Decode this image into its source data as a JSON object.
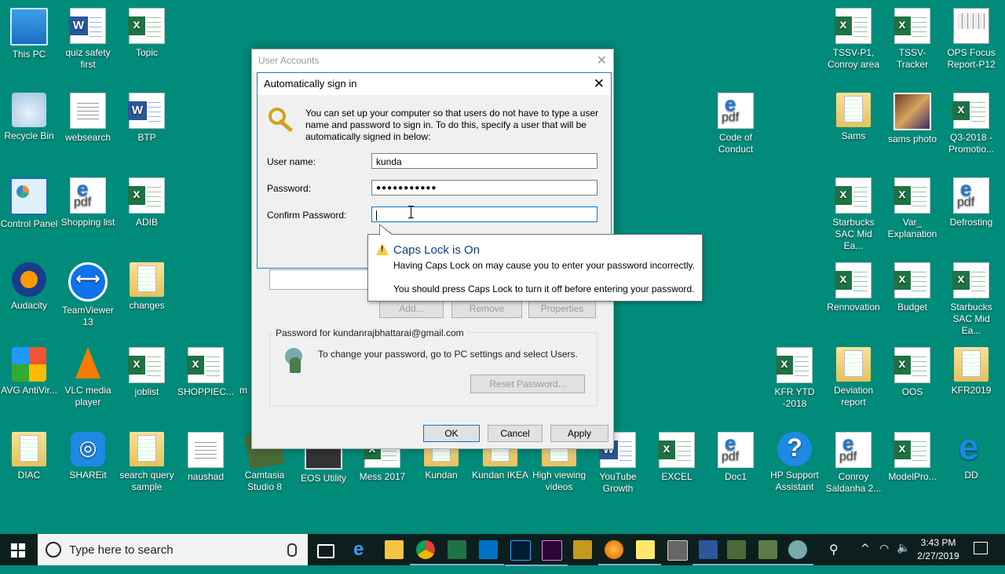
{
  "desktop": {
    "icons_left": [
      {
        "label": "This PC",
        "icon": "this-pc-icon"
      },
      {
        "label": "quiz safety first",
        "icon": "word-doc-icon"
      },
      {
        "label": "Topic",
        "icon": "excel-file-icon"
      },
      {
        "label": "Recycle Bin",
        "icon": "recycle-bin-icon"
      },
      {
        "label": "websearch",
        "icon": "document-icon"
      },
      {
        "label": "BTP",
        "icon": "word-doc-icon"
      },
      {
        "label": "Control Panel",
        "icon": "control-panel-icon"
      },
      {
        "label": "Shopping list",
        "icon": "pdf-icon"
      },
      {
        "label": "ADIB",
        "icon": "excel-file-icon"
      },
      {
        "label": "Audacity",
        "icon": "audacity-icon"
      },
      {
        "label": "TeamViewer 13",
        "icon": "teamviewer-icon"
      },
      {
        "label": "changes",
        "icon": "folder-icon"
      },
      {
        "label": "AVG AntiVir...",
        "icon": "avg-icon"
      },
      {
        "label": "VLC media player",
        "icon": "vlc-icon"
      },
      {
        "label": "joblist",
        "icon": "excel-file-icon"
      },
      {
        "label": "SHOPPIEC...",
        "icon": "excel-file-icon"
      },
      {
        "label": "m",
        "icon": "folder-icon"
      }
    ],
    "icons_bottom": [
      {
        "label": "DIAC",
        "icon": "folder-icon"
      },
      {
        "label": "SHAREit",
        "icon": "shareit-icon"
      },
      {
        "label": "search query sample",
        "icon": "folder-icon"
      },
      {
        "label": "naushad",
        "icon": "document-icon"
      },
      {
        "label": "Camtasia Studio 8",
        "icon": "camtasia-icon"
      },
      {
        "label": "EOS Utility",
        "icon": "eos-utility-icon"
      },
      {
        "label": "Mess 2017",
        "icon": "excel-file-icon"
      },
      {
        "label": "Kundan",
        "icon": "folder-icon"
      },
      {
        "label": "Kundan IKEA",
        "icon": "folder-icon"
      },
      {
        "label": "High viewing videos",
        "icon": "folder-icon"
      },
      {
        "label": "YouTube Growth",
        "icon": "word-doc-icon"
      },
      {
        "label": "EXCEL",
        "icon": "excel-file-icon"
      },
      {
        "label": "Doc1",
        "icon": "pdf-icon"
      },
      {
        "label": "HP Support Assistant",
        "icon": "help-icon"
      },
      {
        "label": "Conroy Saldanha 2...",
        "icon": "pdf-icon"
      },
      {
        "label": "ModelPro...",
        "icon": "excel-file-icon"
      },
      {
        "label": "DD",
        "icon": "internet-explorer-icon"
      }
    ],
    "icons_right": [
      {
        "label": "TSSV-P1, Conroy area",
        "icon": "excel-file-icon"
      },
      {
        "label": "TSSV-Tracker",
        "icon": "excel-file-icon"
      },
      {
        "label": "OPS Focus Report-P12",
        "icon": "spreadsheet-icon"
      },
      {
        "label": "Code of Conduct",
        "icon": "pdf-icon"
      },
      {
        "label": "Sams",
        "icon": "folder-icon"
      },
      {
        "label": "sams photo",
        "icon": "photo-icon"
      },
      {
        "label": "Q3-2018 -Promotio...",
        "icon": "excel-file-icon"
      },
      {
        "label": "Starbucks SAC Mid Ea...",
        "icon": "excel-file-icon"
      },
      {
        "label": "Var_ Explanation",
        "icon": "excel-file-icon"
      },
      {
        "label": "Defrosting",
        "icon": "pdf-icon"
      },
      {
        "label": "Rennovation",
        "icon": "excel-file-icon"
      },
      {
        "label": "Budget",
        "icon": "excel-file-icon"
      },
      {
        "label": "Starbucks SAC Mid Ea...",
        "icon": "excel-file-icon"
      },
      {
        "label": "KFR YTD -2018",
        "icon": "excel-file-icon"
      },
      {
        "label": "Deviation report",
        "icon": "folder-icon"
      },
      {
        "label": "OOS",
        "icon": "excel-file-icon"
      },
      {
        "label": "KFR2019",
        "icon": "folder-icon"
      }
    ]
  },
  "user_accounts": {
    "title": "User Accounts",
    "list_buttons": {
      "add": "Add...",
      "remove": "Remove",
      "properties": "Properties"
    },
    "password_group_title": "Password for kundanrajbhattarai@gmail.com",
    "password_group_text": "To change your password, go to PC settings and select Users.",
    "reset_password": "Reset Password...",
    "ok": "OK",
    "cancel": "Cancel",
    "apply": "Apply"
  },
  "auto_sign_in": {
    "title": "Automatically sign in",
    "description": "You can set up your computer so that users do not have to type a user name and password to sign in. To do this, specify a user that will be automatically signed in below:",
    "username_label": "User name:",
    "username_value": "kunda",
    "password_label": "Password:",
    "password_value": "●●●●●●●●●●●",
    "confirm_label": "Confirm Password:",
    "confirm_value": ""
  },
  "caps_tooltip": {
    "title": "Caps Lock is On",
    "line1": "Having Caps Lock on may cause you to enter your password incorrectly.",
    "line2": "You should press Caps Lock to turn it off before entering your password."
  },
  "taskbar": {
    "search_placeholder": "Type here to search",
    "time": "3:43 PM",
    "date": "2/27/2019",
    "apps": [
      "task-view-icon",
      "edge-icon",
      "file-explorer-icon",
      "chrome-icon",
      "excel-icon",
      "outlook-icon",
      "photoshop-icon",
      "premiere-icon",
      "app-icon",
      "firefox-icon",
      "sticky-notes-icon",
      "calculator-icon",
      "word-icon",
      "app-icon",
      "app-icon",
      "user-accounts-icon"
    ]
  },
  "colors": {
    "desktop": "#008b7a",
    "taskbar": "#0c1f1d",
    "accent": "#0078d7"
  }
}
